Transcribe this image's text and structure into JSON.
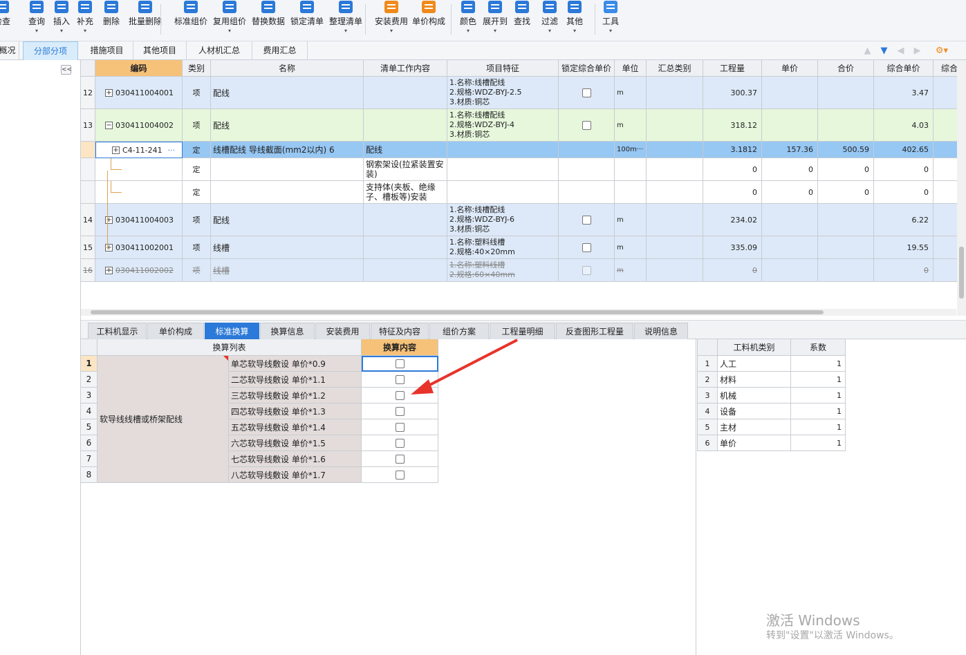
{
  "toolbar": {
    "buttons": [
      {
        "label": "检查",
        "has_menu": false
      },
      {
        "label": "查询",
        "has_menu": true
      },
      {
        "label": "插入",
        "has_menu": true
      },
      {
        "label": "补充",
        "has_menu": true
      },
      {
        "label": "删除",
        "has_menu": false
      },
      {
        "label": "批量删除",
        "has_menu": false
      },
      {
        "label": "标准组价",
        "has_menu": false
      },
      {
        "label": "复用组价",
        "has_menu": true
      },
      {
        "label": "替换数据",
        "has_menu": false
      },
      {
        "label": "锁定清单",
        "has_menu": false
      },
      {
        "label": "整理清单",
        "has_menu": true
      },
      {
        "label": "安装费用",
        "has_menu": true
      },
      {
        "label": "单价构成",
        "has_menu": false
      },
      {
        "label": "颜色",
        "has_menu": true
      },
      {
        "label": "展开到",
        "has_menu": true
      },
      {
        "label": "查找",
        "has_menu": false
      },
      {
        "label": "过滤",
        "has_menu": true
      },
      {
        "label": "其他",
        "has_menu": true
      },
      {
        "label": "工具",
        "has_menu": true
      }
    ]
  },
  "top_tabs": [
    "概况",
    "分部分项",
    "措施项目",
    "其他项目",
    "人材机汇总",
    "费用汇总"
  ],
  "active_top_tab": "分部分项",
  "collapse_label": "<<",
  "grid": {
    "columns": [
      "",
      "编码",
      "类别",
      "名称",
      "清单工作内容",
      "项目特征",
      "锁定综合单价",
      "单位",
      "汇总类别",
      "工程量",
      "单价",
      "合价",
      "综合单价",
      "综合"
    ],
    "rows": [
      {
        "num": "12",
        "code": "030411004001",
        "type": "项",
        "name": "配线",
        "work": "",
        "features": "1.名称:线槽配线\n2.规格:WDZ-BYJ-2.5\n3.材质:铜芯",
        "lock": true,
        "unit": "m",
        "qty": "300.37",
        "price": "",
        "total": "",
        "unit_price": "3.47",
        "style": "blue"
      },
      {
        "num": "13",
        "code": "030411004002",
        "type": "项",
        "name": "配线",
        "work": "",
        "features": "1.名称:线槽配线\n2.规格:WDZ-BYJ-4\n3.材质:铜芯",
        "lock": true,
        "unit": "m",
        "qty": "318.12",
        "price": "",
        "total": "",
        "unit_price": "4.03",
        "style": "green"
      },
      {
        "num": "",
        "code": "C4-11-241",
        "type": "定",
        "name": "线槽配线 导线截面(mm2以内) 6",
        "work": "配线",
        "features": "",
        "lock": false,
        "unit": "100m···",
        "qty": "3.1812",
        "price": "157.36",
        "total": "500.59",
        "unit_price": "402.65",
        "style": "selected"
      },
      {
        "num": "",
        "code": "",
        "type": "定",
        "name": "",
        "work": "钢索架设(拉紧装置安\n装)",
        "features": "",
        "lock": false,
        "unit": "",
        "qty": "0",
        "price": "0",
        "total": "0",
        "unit_price": "0",
        "style": "white"
      },
      {
        "num": "",
        "code": "",
        "type": "定",
        "name": "",
        "work": "支持体(夹板、绝缘\n子、槽板等)安装",
        "features": "",
        "lock": false,
        "unit": "",
        "qty": "0",
        "price": "0",
        "total": "0",
        "unit_price": "0",
        "style": "white"
      },
      {
        "num": "14",
        "code": "030411004003",
        "type": "项",
        "name": "配线",
        "work": "",
        "features": "1.名称:线槽配线\n2.规格:WDZ-BYJ-6\n3.材质:铜芯",
        "lock": true,
        "unit": "m",
        "qty": "234.02",
        "price": "",
        "total": "",
        "unit_price": "6.22",
        "style": "blue"
      },
      {
        "num": "15",
        "code": "030411002001",
        "type": "项",
        "name": "线槽",
        "work": "",
        "features": "1.名称:塑料线槽\n2.规格:40×20mm",
        "lock": true,
        "unit": "m",
        "qty": "335.09",
        "price": "",
        "total": "",
        "unit_price": "19.55",
        "style": "blue"
      },
      {
        "num": "16",
        "code": "030411002002",
        "type": "项",
        "name": "线槽",
        "work": "",
        "features": "1.名称:塑料线槽\n2.规格:60×40mm",
        "lock": true,
        "unit": "m",
        "qty": "0",
        "price": "",
        "total": "",
        "unit_price": "0",
        "style": "strike"
      }
    ]
  },
  "lower_tabs": [
    "工料机显示",
    "单价构成",
    "标准换算",
    "换算信息",
    "安装费用",
    "特征及内容",
    "组价方案",
    "工程量明细",
    "反查图形工程量",
    "说明信息"
  ],
  "active_lower_tab": "标准换算",
  "conversion": {
    "header_list": "换算列表",
    "header_content": "换算内容",
    "group_label": "软导线线槽或桥架配线",
    "items": [
      {
        "num": "1",
        "text": "单芯软导线敷设 单价*0.9"
      },
      {
        "num": "2",
        "text": "二芯软导线敷设 单价*1.1"
      },
      {
        "num": "3",
        "text": "三芯软导线敷设 单价*1.2"
      },
      {
        "num": "4",
        "text": "四芯软导线敷设 单价*1.3"
      },
      {
        "num": "5",
        "text": "五芯软导线敷设 单价*1.4"
      },
      {
        "num": "6",
        "text": "六芯软导线敷设 单价*1.5"
      },
      {
        "num": "7",
        "text": "七芯软导线敷设 单价*1.6"
      },
      {
        "num": "8",
        "text": "八芯软导线敷设 单价*1.7"
      }
    ]
  },
  "coefficients": {
    "header_type": "工料机类别",
    "header_factor": "系数",
    "rows": [
      {
        "num": "1",
        "type": "人工",
        "factor": "1"
      },
      {
        "num": "2",
        "type": "材料",
        "factor": "1"
      },
      {
        "num": "3",
        "type": "机械",
        "factor": "1"
      },
      {
        "num": "4",
        "type": "设备",
        "factor": "1"
      },
      {
        "num": "5",
        "type": "主材",
        "factor": "1"
      },
      {
        "num": "6",
        "type": "单价",
        "factor": "1"
      }
    ]
  },
  "watermark": {
    "line1": "激活 Windows",
    "line2": "转到\"设置\"以激活 Windows。"
  },
  "colors": {
    "accent": "#2b79d8",
    "row_blue": "#dde9f8",
    "row_green": "#e6f7dc",
    "row_selected": "#97c7f3",
    "code_header": "#f6c27a",
    "conv_group_bg": "#e3dcdb",
    "arrow_red": "#e8332a"
  }
}
